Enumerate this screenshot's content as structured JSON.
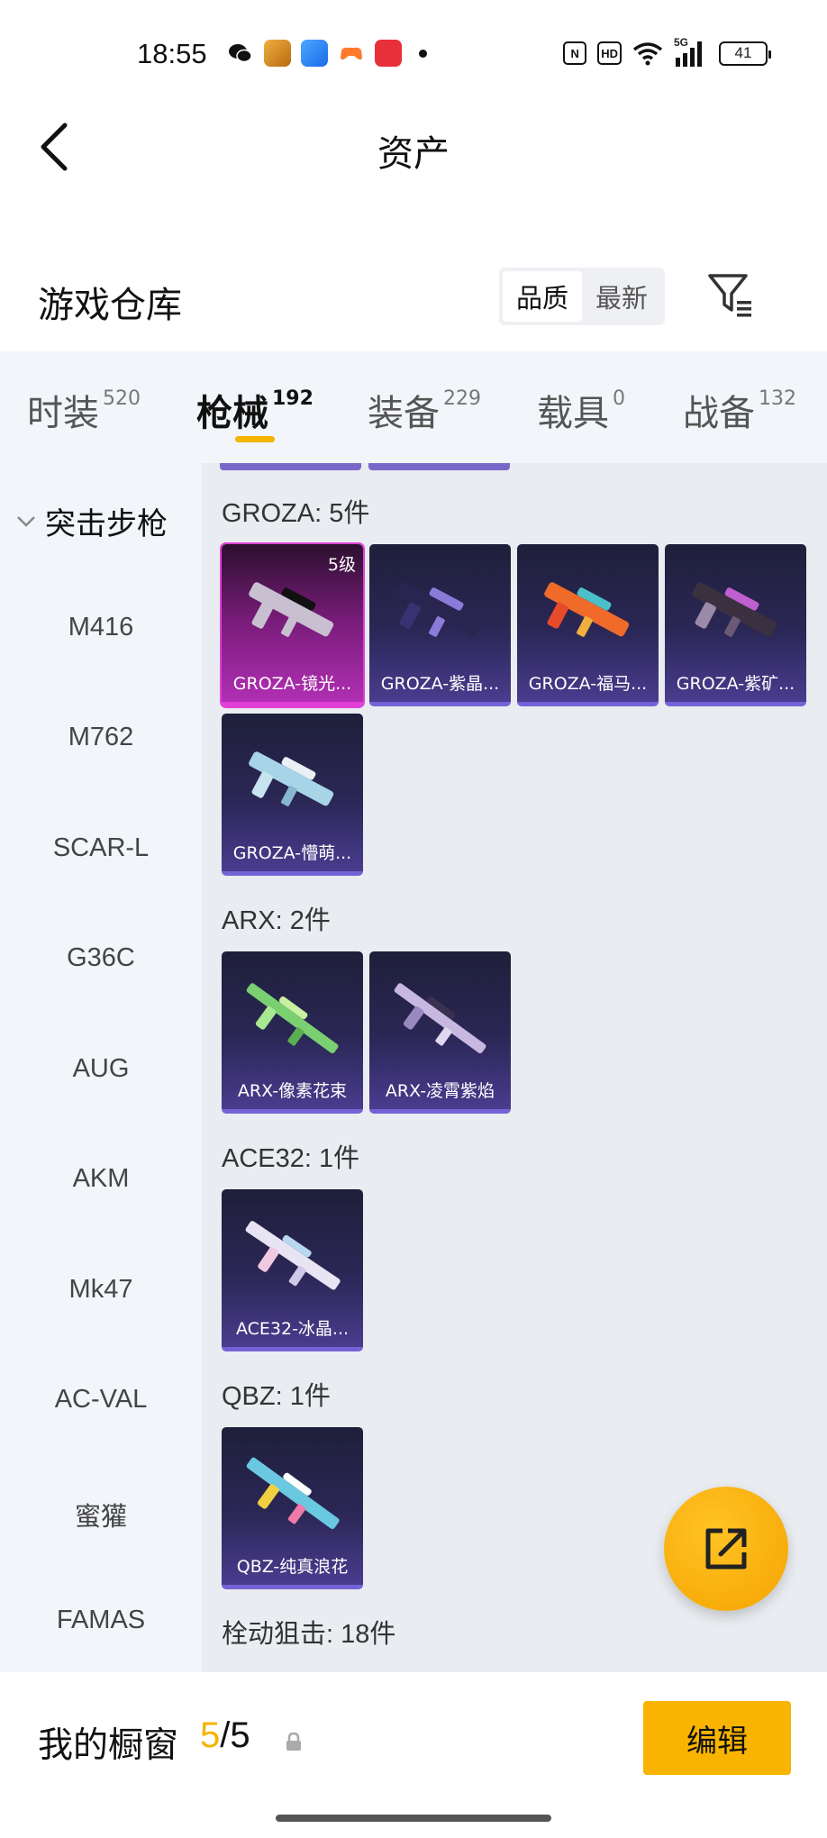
{
  "status": {
    "time": "18:55",
    "hd_label": "HD",
    "nfc_label": "N",
    "signal_label": "5G",
    "battery": "41"
  },
  "header": {
    "title": "资产"
  },
  "warehouse": {
    "title": "游戏仓库",
    "sort_options": [
      "品质",
      "最新"
    ],
    "active_sort": "品质"
  },
  "tabs": [
    {
      "label": "时装",
      "count": "520",
      "active": false
    },
    {
      "label": "枪械",
      "count": "192",
      "active": true
    },
    {
      "label": "装备",
      "count": "229",
      "active": false
    },
    {
      "label": "载具",
      "count": "0",
      "active": false
    },
    {
      "label": "战备",
      "count": "132",
      "active": false
    }
  ],
  "sidebar": {
    "category": "突击步枪",
    "items": [
      "M416",
      "M762",
      "SCAR-L",
      "G36C",
      "AUG",
      "AKM",
      "Mk47",
      "AC-VAL",
      "蜜獾",
      "FAMAS"
    ]
  },
  "groups": [
    {
      "title": "GROZA: 5件",
      "items": [
        {
          "name": "GROZA-镜光...",
          "level": "5级",
          "rarity": "pink",
          "accent": "#c8c0d0"
        },
        {
          "name": "GROZA-紫晶...",
          "level": "",
          "rarity": "purple",
          "accent": "#8a7bd8"
        },
        {
          "name": "GROZA-福马...",
          "level": "",
          "rarity": "purple",
          "accent": "#f06a2a"
        },
        {
          "name": "GROZA-紫矿...",
          "level": "",
          "rarity": "purple",
          "accent": "#9a8aa8"
        },
        {
          "name": "GROZA-懵萌...",
          "level": "",
          "rarity": "purple",
          "accent": "#a8d4e8"
        }
      ]
    },
    {
      "title": "ARX: 2件",
      "items": [
        {
          "name": "ARX-像素花束",
          "level": "",
          "rarity": "purple",
          "accent": "#7ad070"
        },
        {
          "name": "ARX-凌霄紫焰",
          "level": "",
          "rarity": "purple",
          "accent": "#c8b8e0"
        }
      ]
    },
    {
      "title": "ACE32: 1件",
      "items": [
        {
          "name": "ACE32-冰晶...",
          "level": "",
          "rarity": "purple",
          "accent": "#e8e4f4"
        }
      ]
    },
    {
      "title": "QBZ: 1件",
      "items": [
        {
          "name": "QBZ-纯真浪花",
          "level": "",
          "rarity": "purple",
          "accent": "#6ac8e0"
        }
      ]
    },
    {
      "title": "栓动狙击: 18件",
      "items": []
    }
  ],
  "showcase": {
    "label": "我的橱窗",
    "current": "5",
    "separator": "/",
    "total": "5",
    "edit_label": "编辑"
  },
  "colors": {
    "accent": "#f5b400",
    "card_purple": "#7562d6",
    "card_pink": "#e03fd8"
  }
}
